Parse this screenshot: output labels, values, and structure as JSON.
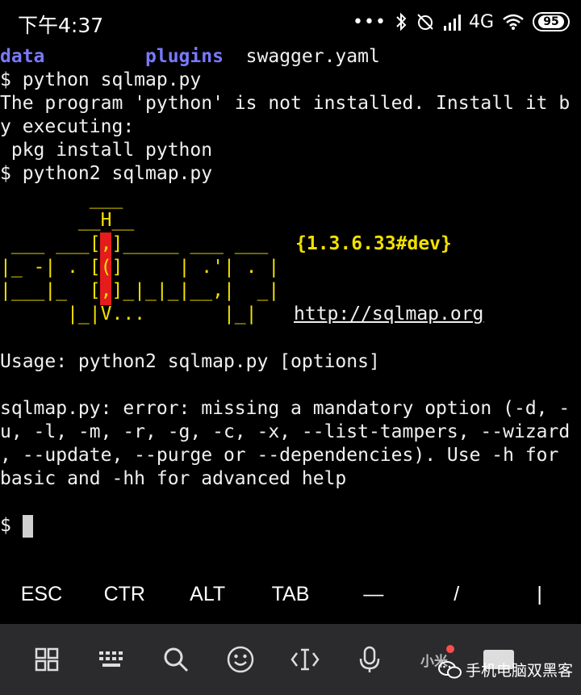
{
  "status_bar": {
    "time": "下午4:37",
    "dots": "•••",
    "network": "4G",
    "battery": "95",
    "icons": [
      "bluetooth-icon",
      "alarm-off-icon",
      "signal-icon",
      "wifi-icon",
      "battery-icon"
    ]
  },
  "terminal": {
    "ls_output": [
      "data",
      "plugins",
      "swagger.yaml"
    ],
    "lines": [
      "$ python sqlmap.py",
      "The program 'python' is not installed. Install it b",
      "y executing:",
      " pkg install python",
      "$ python2 sqlmap.py"
    ],
    "logo": [
      "        ___",
      "       __H__",
      " ___ ___[,]_____ ___ ___",
      "|_ -| . [(]     | .'| . |",
      "|___|_  [,]_|_|_|__,|  _|",
      "      |_|V...       |_|"
    ],
    "version": "{1.3.6.33#dev}",
    "url": "http://sqlmap.org",
    "usage": "Usage: python2 sqlmap.py [options]",
    "error_lines": [
      "sqlmap.py: error: missing a mandatory option (-d, -",
      "u, -l, -m, -r, -g, -c, -x, --list-tampers, --wizard",
      ", --update, --purge or --dependencies). Use -h for",
      "basic and -hh for advanced help"
    ],
    "prompt": "$"
  },
  "extra_keys": [
    "ESC",
    "CTR",
    "ALT",
    "TAB",
    "—",
    "/",
    "|"
  ],
  "toolbar": {
    "items": [
      "grid-icon",
      "keyboard-icon",
      "search-icon",
      "emoji-icon",
      "cursor-move-icon",
      "microphone-icon",
      "xiaoyi-icon",
      "collapse-keyboard-icon"
    ],
    "xiaoyi_label": "小米"
  },
  "watermark": "手机电脑双黑客",
  "colors": {
    "dir": "#7979ff",
    "logo": "#f2e100",
    "logo_accent": "#e31c1c",
    "toolbar_bg": "#2b2b2d"
  }
}
